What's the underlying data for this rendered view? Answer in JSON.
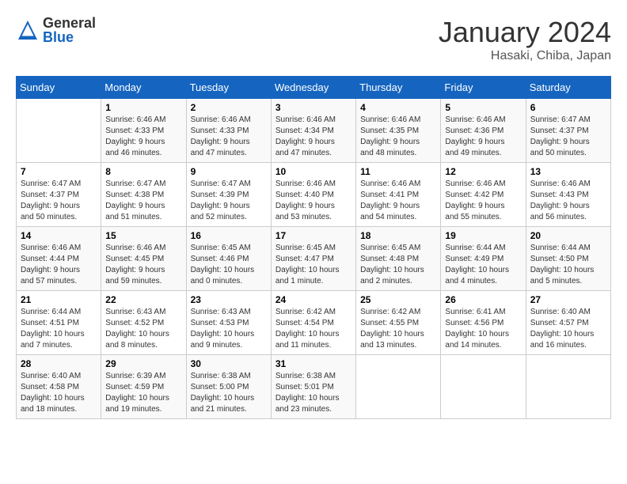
{
  "header": {
    "logo_general": "General",
    "logo_blue": "Blue",
    "month_title": "January 2024",
    "location": "Hasaki, Chiba, Japan"
  },
  "calendar": {
    "days_of_week": [
      "Sunday",
      "Monday",
      "Tuesday",
      "Wednesday",
      "Thursday",
      "Friday",
      "Saturday"
    ],
    "weeks": [
      [
        {
          "day": "",
          "info": ""
        },
        {
          "day": "1",
          "info": "Sunrise: 6:46 AM\nSunset: 4:33 PM\nDaylight: 9 hours\nand 46 minutes."
        },
        {
          "day": "2",
          "info": "Sunrise: 6:46 AM\nSunset: 4:33 PM\nDaylight: 9 hours\nand 47 minutes."
        },
        {
          "day": "3",
          "info": "Sunrise: 6:46 AM\nSunset: 4:34 PM\nDaylight: 9 hours\nand 47 minutes."
        },
        {
          "day": "4",
          "info": "Sunrise: 6:46 AM\nSunset: 4:35 PM\nDaylight: 9 hours\nand 48 minutes."
        },
        {
          "day": "5",
          "info": "Sunrise: 6:46 AM\nSunset: 4:36 PM\nDaylight: 9 hours\nand 49 minutes."
        },
        {
          "day": "6",
          "info": "Sunrise: 6:47 AM\nSunset: 4:37 PM\nDaylight: 9 hours\nand 50 minutes."
        }
      ],
      [
        {
          "day": "7",
          "info": "Sunrise: 6:47 AM\nSunset: 4:37 PM\nDaylight: 9 hours\nand 50 minutes."
        },
        {
          "day": "8",
          "info": "Sunrise: 6:47 AM\nSunset: 4:38 PM\nDaylight: 9 hours\nand 51 minutes."
        },
        {
          "day": "9",
          "info": "Sunrise: 6:47 AM\nSunset: 4:39 PM\nDaylight: 9 hours\nand 52 minutes."
        },
        {
          "day": "10",
          "info": "Sunrise: 6:46 AM\nSunset: 4:40 PM\nDaylight: 9 hours\nand 53 minutes."
        },
        {
          "day": "11",
          "info": "Sunrise: 6:46 AM\nSunset: 4:41 PM\nDaylight: 9 hours\nand 54 minutes."
        },
        {
          "day": "12",
          "info": "Sunrise: 6:46 AM\nSunset: 4:42 PM\nDaylight: 9 hours\nand 55 minutes."
        },
        {
          "day": "13",
          "info": "Sunrise: 6:46 AM\nSunset: 4:43 PM\nDaylight: 9 hours\nand 56 minutes."
        }
      ],
      [
        {
          "day": "14",
          "info": "Sunrise: 6:46 AM\nSunset: 4:44 PM\nDaylight: 9 hours\nand 57 minutes."
        },
        {
          "day": "15",
          "info": "Sunrise: 6:46 AM\nSunset: 4:45 PM\nDaylight: 9 hours\nand 59 minutes."
        },
        {
          "day": "16",
          "info": "Sunrise: 6:45 AM\nSunset: 4:46 PM\nDaylight: 10 hours\nand 0 minutes."
        },
        {
          "day": "17",
          "info": "Sunrise: 6:45 AM\nSunset: 4:47 PM\nDaylight: 10 hours\nand 1 minute."
        },
        {
          "day": "18",
          "info": "Sunrise: 6:45 AM\nSunset: 4:48 PM\nDaylight: 10 hours\nand 2 minutes."
        },
        {
          "day": "19",
          "info": "Sunrise: 6:44 AM\nSunset: 4:49 PM\nDaylight: 10 hours\nand 4 minutes."
        },
        {
          "day": "20",
          "info": "Sunrise: 6:44 AM\nSunset: 4:50 PM\nDaylight: 10 hours\nand 5 minutes."
        }
      ],
      [
        {
          "day": "21",
          "info": "Sunrise: 6:44 AM\nSunset: 4:51 PM\nDaylight: 10 hours\nand 7 minutes."
        },
        {
          "day": "22",
          "info": "Sunrise: 6:43 AM\nSunset: 4:52 PM\nDaylight: 10 hours\nand 8 minutes."
        },
        {
          "day": "23",
          "info": "Sunrise: 6:43 AM\nSunset: 4:53 PM\nDaylight: 10 hours\nand 9 minutes."
        },
        {
          "day": "24",
          "info": "Sunrise: 6:42 AM\nSunset: 4:54 PM\nDaylight: 10 hours\nand 11 minutes."
        },
        {
          "day": "25",
          "info": "Sunrise: 6:42 AM\nSunset: 4:55 PM\nDaylight: 10 hours\nand 13 minutes."
        },
        {
          "day": "26",
          "info": "Sunrise: 6:41 AM\nSunset: 4:56 PM\nDaylight: 10 hours\nand 14 minutes."
        },
        {
          "day": "27",
          "info": "Sunrise: 6:40 AM\nSunset: 4:57 PM\nDaylight: 10 hours\nand 16 minutes."
        }
      ],
      [
        {
          "day": "28",
          "info": "Sunrise: 6:40 AM\nSunset: 4:58 PM\nDaylight: 10 hours\nand 18 minutes."
        },
        {
          "day": "29",
          "info": "Sunrise: 6:39 AM\nSunset: 4:59 PM\nDaylight: 10 hours\nand 19 minutes."
        },
        {
          "day": "30",
          "info": "Sunrise: 6:38 AM\nSunset: 5:00 PM\nDaylight: 10 hours\nand 21 minutes."
        },
        {
          "day": "31",
          "info": "Sunrise: 6:38 AM\nSunset: 5:01 PM\nDaylight: 10 hours\nand 23 minutes."
        },
        {
          "day": "",
          "info": ""
        },
        {
          "day": "",
          "info": ""
        },
        {
          "day": "",
          "info": ""
        }
      ]
    ]
  }
}
